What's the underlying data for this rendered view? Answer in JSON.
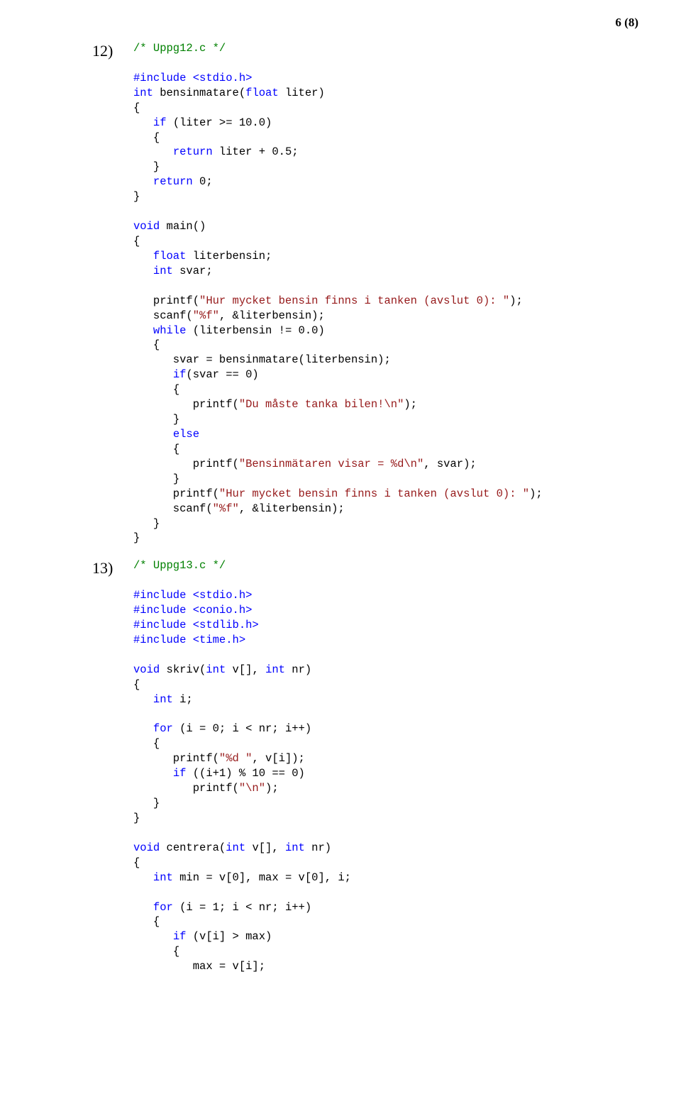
{
  "page_number": "6 (8)",
  "item12_num": "12)",
  "item13_num": "13)",
  "c12": {
    "l0": "/* Uppg12.c */",
    "incStdio": "#include <stdio.h>",
    "kw_int": "int",
    "kw_float": "float",
    "kw_if": "if",
    "kw_return": "return",
    "kw_void": "void",
    "kw_while": "while",
    "kw_else": "else",
    "kw_for": "for",
    "fn_bensin": " bensinmatare(",
    "p_liter": " liter)",
    "lb": "{",
    "rb": "}",
    "if_liter": " (liter >= 10.0)",
    "ret_liter": " liter + 0.5;",
    "ret0": " 0;",
    "main": " main()",
    "fl_lb": " literbensin;",
    "int_sv": " svar;",
    "pf_hur": "   printf(",
    "s_hur": "\"Hur mycket bensin finns i tanken (avslut 0): \"",
    "scanf": "   scanf(",
    "s_pf": "\"%f\"",
    "amp": ", &literbensin);",
    "wh_cond": " (literbensin != 0.0)",
    "svar_asg": "      svar = bensinmatare(literbensin);",
    "if_svar": "(svar == 0)",
    "pf_du": "         printf(",
    "s_du": "\"Du måste tanka bilen!\\n\"",
    "pf_bm": "         printf(",
    "s_bm": "\"Bensinmätaren visar = %d\\n\"",
    "sv_arg": ", svar);",
    "pf_hur2": "      printf(",
    "scanf2": "      scanf(",
    "e_semic": ");",
    "e_paren": ");"
  },
  "c13": {
    "l0": "/* Uppg13.c */",
    "incStdio": "#include <stdio.h>",
    "incConio": "#include <conio.h>",
    "incStdlib": "#include <stdlib.h>",
    "incTime": "#include <time.h>",
    "kw_void": "void",
    "kw_int": "int",
    "kw_for": "for",
    "kw_if": "if",
    "skriv": " skriv(",
    "skriv2": " v[], ",
    "nr": " nr)",
    "inti": " i;",
    "for1": " (i = 0; i < nr; i++)",
    "pf_d": "      printf(",
    "s_d": "\"%d \"",
    "vi": ", v[i]);",
    "if_mod": " ((i+1) % 10 == 0)",
    "pf_n": "         printf(",
    "s_n": "\"\\n\"",
    "centrera": " centrera(",
    "minmax": " min = v[0], max = v[0], i;",
    "for2": " (i = 1; i < nr; i++)",
    "if_max": " (v[i] > max)",
    "maxasg": "         max = v[i];"
  }
}
